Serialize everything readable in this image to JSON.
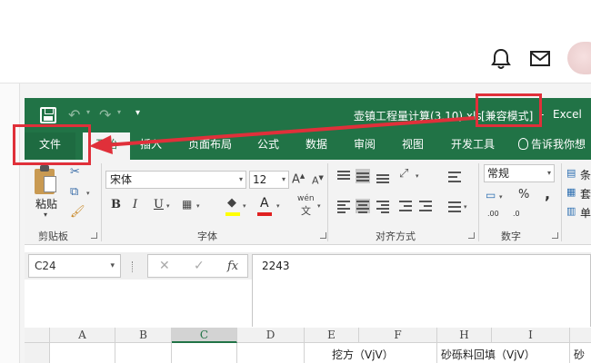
{
  "excel": {
    "title": {
      "file_name": "壶镇工程量计算(3.10).xls",
      "compat_mode": "[兼容模式]",
      "separator": "-",
      "app_name": "Excel"
    },
    "tabs": [
      "文件",
      "开始",
      "插入",
      "页面布局",
      "公式",
      "数据",
      "审阅",
      "视图",
      "开发工具"
    ],
    "tell_me": "告诉我你想",
    "ribbon": {
      "clipboard": {
        "paste_label": "粘贴",
        "group_label": "剪贴板"
      },
      "font": {
        "font_name": "宋体",
        "font_size": "12",
        "bold": "B",
        "italic": "I",
        "underline": "U",
        "font_color_glyph": "A",
        "wen_glyph": "wén",
        "wen_sub": "文",
        "grow": "A",
        "shrink": "A",
        "group_label": "字体"
      },
      "alignment": {
        "group_label": "对齐方式"
      },
      "number": {
        "format": "常规",
        "percent": "%",
        "comma": ",",
        "inc_decimal": ".00",
        "dec_decimal": ".0",
        "group_label": "数字"
      },
      "cells": {
        "labels": [
          "条",
          "套",
          "单"
        ]
      }
    },
    "formula_bar": {
      "name_box": "C24",
      "cancel": "✕",
      "enter": "✓",
      "fx": "fx",
      "value": "2243"
    },
    "columns": [
      "A",
      "B",
      "C",
      "D",
      "E",
      "F",
      "H",
      "I"
    ],
    "selected_column": "C",
    "row_cells": {
      "e": "挖方（VjV）",
      "h": "砂砾料回填（VjV）",
      "last": "砂"
    }
  }
}
